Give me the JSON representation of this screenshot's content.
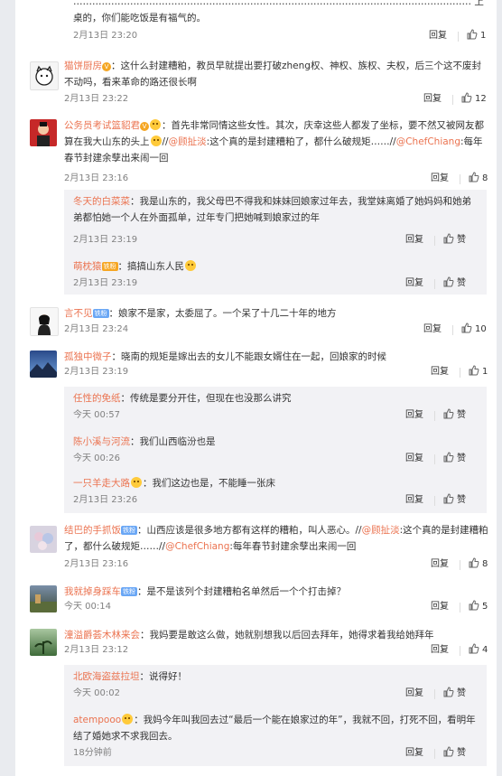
{
  "ui": {
    "reply": "回复",
    "zan": "赞",
    "accent": "#eb7350"
  },
  "top": {
    "text": "……………………………………………………………………………………………………………… 上桌的，你们能吃饭是有福气的。",
    "time": "2月13日 23:20",
    "likes": "1"
  },
  "comments": [
    {
      "name": "猫饼厨房",
      "text": "：这什么封建糟粕，教员早就提出要打破zheng权、神权、族权、夫权，后三个这不废封不动吗，看来革命的路还很长啊",
      "time": "2月13日 23:22",
      "likes": "12"
    },
    {
      "name": "公务员考试篮貂君",
      "text": "：首先非常同情这些女性。其次，庆幸这些人都发了坐标，要不然又被网友都算在我大山东的头上",
      "m1": "@顾扯淡",
      "t2": ":这个真的是封建糟粕了，都什么破规矩……//",
      "m2": "@ChefChiang",
      "t3": ":每年春节封建余孽出来闹一回",
      "time": "2月13日 23:16",
      "likes": "8"
    },
    {
      "name": "冬天的白菜菜",
      "text": "：我是山东的，我父母巴不得我和妹妹回娘家过年去，我堂妹离婚了她妈妈和她弟弟都怕她一个人在外面孤单，过年专门把她喊到娘家过的年",
      "time": "2月13日 23:19",
      "likes": "赞"
    },
    {
      "name": "萌枕猿",
      "text": "：搞搞山东人民",
      "time": "2月13日 23:19",
      "likes": "赞"
    },
    {
      "name": "言不见",
      "badge": "铁粉",
      "text": "：娘家不是家，太委屈了。一个呆了十几二十年的地方",
      "time": "2月13日 23:24",
      "likes": "10"
    },
    {
      "name": "孤独中微子",
      "text": "：晓南的规矩是嫁出去的女儿不能跟女婿住在一起，回娘家的时候",
      "time": "2月13日 23:19",
      "likes": "1"
    },
    {
      "name": "任性的免纸",
      "text": "：传统是要分开住，但现在也没那么讲究",
      "time": "今天 00:57",
      "likes": "赞"
    },
    {
      "name": "陈小溪与河流",
      "text": "：我们山西临汾也是",
      "time": "今天 00:26",
      "likes": "赞"
    },
    {
      "name": "一只羊走大路",
      "text": "：我们这边也是，不能睡一张床",
      "time": "2月13日 23:26",
      "likes": "赞"
    },
    {
      "name": "结巴的手抓饭",
      "badge": "铁粉",
      "text": "：山西应该是很多地方都有这样的糟粕，叫人恶心。//",
      "m1": "@顾扯淡",
      "t2": ":这个真的是封建糟粕了，都什么破规矩……//",
      "m2": "@ChefChiang",
      "t3": ":每年春节封建余孽出来闹一回",
      "time": "2月13日 23:16",
      "likes": "8"
    },
    {
      "name": "我就掉身踩车",
      "badge": "铁粉",
      "text": "：是不是该列个封建糟粕名单然后一个个打击掉？",
      "time": "今天 00:14",
      "likes": "5"
    },
    {
      "name": "潼溢爵荟木林来会",
      "text": "：我妈要是敢这么做，她就别想我以后回去拜年，她得求着我给她拜年",
      "time": "2月13日 23:12",
      "likes": "4"
    },
    {
      "name": "北欧海盗兹拉坦",
      "text": "：说得好！",
      "time": "今天 00:02",
      "likes": "赞"
    },
    {
      "name": "atempooo",
      "text": "：我妈今年叫我回去过“最后一个能在娘家过的年”，我就不回，打死不回，看明年结了婚她求不求我回去。",
      "time": "18分钟前",
      "likes": "赞"
    }
  ]
}
